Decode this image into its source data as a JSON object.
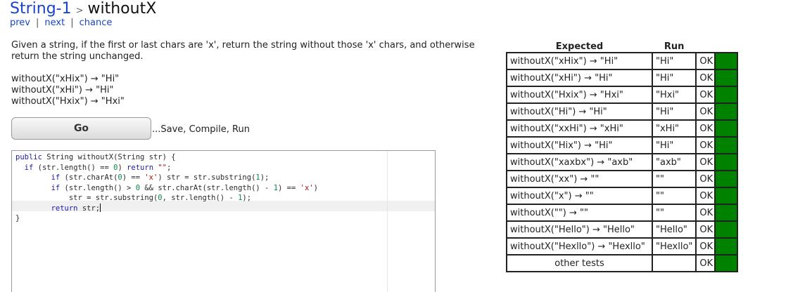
{
  "header": {
    "category": "String-1",
    "separator": ">",
    "problem": "withoutX"
  },
  "nav": {
    "prev": "prev",
    "next": "next",
    "chance": "chance",
    "divider": "|"
  },
  "description": "Given a string, if the first or last chars are 'x', return the string without those 'x' chars, and otherwise return the string unchanged.",
  "examples": [
    "withoutX(\"xHix\") → \"Hi\"",
    "withoutX(\"xHi\") → \"Hi\"",
    "withoutX(\"Hxix\") → \"Hxi\""
  ],
  "go": {
    "label": "Go",
    "caption": "...Save, Compile, Run"
  },
  "editor": {
    "lines": [
      "public String withoutX(String str) {",
      "  if (str.length() == 0) return \"\";",
      "        if (str.charAt(0) == 'x') str = str.substring(1);",
      "        if (str.length() > 0 && str.charAt(str.length() - 1) == 'x')",
      "            str = str.substring(0, str.length() - 1);",
      "        return str;",
      "}"
    ]
  },
  "results": {
    "headers": {
      "expected": "Expected",
      "run": "Run"
    },
    "rows": [
      {
        "expected": "withoutX(\"xHix\") → \"Hi\"",
        "run": "\"Hi\"",
        "status": "OK",
        "color": "#008200"
      },
      {
        "expected": "withoutX(\"xHi\") → \"Hi\"",
        "run": "\"Hi\"",
        "status": "OK",
        "color": "#008200"
      },
      {
        "expected": "withoutX(\"Hxix\") → \"Hxi\"",
        "run": "\"Hxi\"",
        "status": "OK",
        "color": "#008200"
      },
      {
        "expected": "withoutX(\"Hi\") → \"Hi\"",
        "run": "\"Hi\"",
        "status": "OK",
        "color": "#008200"
      },
      {
        "expected": "withoutX(\"xxHi\") → \"xHi\"",
        "run": "\"xHi\"",
        "status": "OK",
        "color": "#008200"
      },
      {
        "expected": "withoutX(\"Hix\") → \"Hi\"",
        "run": "\"Hi\"",
        "status": "OK",
        "color": "#008200"
      },
      {
        "expected": "withoutX(\"xaxbx\") → \"axb\"",
        "run": "\"axb\"",
        "status": "OK",
        "color": "#008200"
      },
      {
        "expected": "withoutX(\"xx\") → \"\"",
        "run": "\"\"",
        "status": "OK",
        "color": "#008200"
      },
      {
        "expected": "withoutX(\"x\") → \"\"",
        "run": "\"\"",
        "status": "OK",
        "color": "#008200"
      },
      {
        "expected": "withoutX(\"\") → \"\"",
        "run": "\"\"",
        "status": "OK",
        "color": "#008200"
      },
      {
        "expected": "withoutX(\"Hello\") → \"Hello\"",
        "run": "\"Hello\"",
        "status": "OK",
        "color": "#008200"
      },
      {
        "expected": "withoutX(\"Hexllo\") → \"Hexllo\"",
        "run": "\"Hexllo\"",
        "status": "OK",
        "color": "#008200"
      }
    ],
    "other": {
      "expected": "other tests",
      "run": "",
      "status": "OK",
      "color": "#008200"
    }
  }
}
